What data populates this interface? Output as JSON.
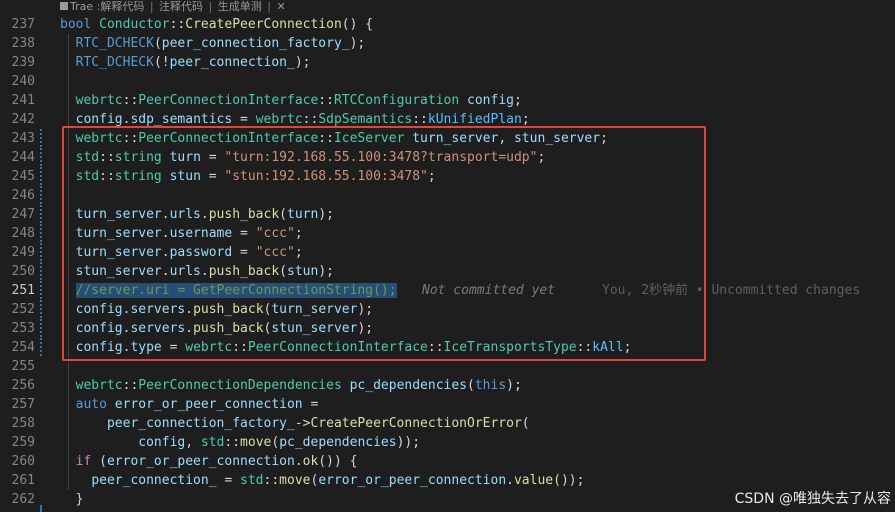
{
  "codelens": {
    "brand": "Trae",
    "explain": "解释代码",
    "comment": "注释代码",
    "unittest": "生成单测",
    "close": "✕"
  },
  "lines": [
    {
      "n": "237",
      "tokens": [
        [
          "kw",
          "bool"
        ],
        [
          "op",
          " "
        ],
        [
          "ty",
          "Conductor"
        ],
        [
          "op",
          "::"
        ],
        [
          "fn",
          "CreatePeerConnection"
        ],
        [
          "op",
          "() {"
        ]
      ]
    },
    {
      "n": "238",
      "tokens": [
        [
          "op",
          "  "
        ],
        [
          "mac",
          "RTC_DCHECK"
        ],
        [
          "op",
          "("
        ],
        [
          "var",
          "peer_connection_factory_"
        ],
        [
          "op",
          ");"
        ]
      ]
    },
    {
      "n": "239",
      "tokens": [
        [
          "op",
          "  "
        ],
        [
          "mac",
          "RTC_DCHECK"
        ],
        [
          "op",
          "(!"
        ],
        [
          "var",
          "peer_connection_"
        ],
        [
          "op",
          ");"
        ]
      ]
    },
    {
      "n": "240",
      "tokens": []
    },
    {
      "n": "241",
      "tokens": [
        [
          "op",
          "  "
        ],
        [
          "ty",
          "webrtc"
        ],
        [
          "op",
          "::"
        ],
        [
          "ty",
          "PeerConnectionInterface"
        ],
        [
          "op",
          "::"
        ],
        [
          "ty",
          "RTCConfiguration"
        ],
        [
          "op",
          " "
        ],
        [
          "var",
          "config"
        ],
        [
          "op",
          ";"
        ]
      ]
    },
    {
      "n": "242",
      "tokens": [
        [
          "op",
          "  "
        ],
        [
          "var",
          "config"
        ],
        [
          "op",
          "."
        ],
        [
          "var",
          "sdp_semantics"
        ],
        [
          "op",
          " = "
        ],
        [
          "ty",
          "webrtc"
        ],
        [
          "op",
          "::"
        ],
        [
          "ty",
          "SdpSemantics"
        ],
        [
          "op",
          "::"
        ],
        [
          "enum",
          "kUnifiedPlan"
        ],
        [
          "op",
          ";"
        ]
      ]
    },
    {
      "n": "243",
      "tokens": [
        [
          "op",
          "  "
        ],
        [
          "ty",
          "webrtc"
        ],
        [
          "op",
          "::"
        ],
        [
          "ty",
          "PeerConnectionInterface"
        ],
        [
          "op",
          "::"
        ],
        [
          "ty",
          "IceServer"
        ],
        [
          "op",
          " "
        ],
        [
          "var",
          "turn_server"
        ],
        [
          "op",
          ", "
        ],
        [
          "var",
          "stun_server"
        ],
        [
          "op",
          ";"
        ]
      ]
    },
    {
      "n": "244",
      "tokens": [
        [
          "op",
          "  "
        ],
        [
          "ty",
          "std"
        ],
        [
          "op",
          "::"
        ],
        [
          "ty",
          "string"
        ],
        [
          "op",
          " "
        ],
        [
          "var",
          "turn"
        ],
        [
          "op",
          " = "
        ],
        [
          "str",
          "\"turn:192.168.55.100:3478?transport=udp\""
        ],
        [
          "op",
          ";"
        ]
      ]
    },
    {
      "n": "245",
      "tokens": [
        [
          "op",
          "  "
        ],
        [
          "ty",
          "std"
        ],
        [
          "op",
          "::"
        ],
        [
          "ty",
          "string"
        ],
        [
          "op",
          " "
        ],
        [
          "var",
          "stun"
        ],
        [
          "op",
          " = "
        ],
        [
          "str",
          "\"stun:192.168.55.100:3478\""
        ],
        [
          "op",
          ";"
        ]
      ]
    },
    {
      "n": "246",
      "tokens": []
    },
    {
      "n": "247",
      "tokens": [
        [
          "op",
          "  "
        ],
        [
          "var",
          "turn_server"
        ],
        [
          "op",
          "."
        ],
        [
          "var",
          "urls"
        ],
        [
          "op",
          "."
        ],
        [
          "fn",
          "push_back"
        ],
        [
          "op",
          "("
        ],
        [
          "var",
          "turn"
        ],
        [
          "op",
          ");"
        ]
      ]
    },
    {
      "n": "248",
      "tokens": [
        [
          "op",
          "  "
        ],
        [
          "var",
          "turn_server"
        ],
        [
          "op",
          "."
        ],
        [
          "var",
          "username"
        ],
        [
          "op",
          " = "
        ],
        [
          "str",
          "\"ccc\""
        ],
        [
          "op",
          ";"
        ]
      ]
    },
    {
      "n": "249",
      "tokens": [
        [
          "op",
          "  "
        ],
        [
          "var",
          "turn_server"
        ],
        [
          "op",
          "."
        ],
        [
          "var",
          "password"
        ],
        [
          "op",
          " = "
        ],
        [
          "str",
          "\"ccc\""
        ],
        [
          "op",
          ";"
        ]
      ]
    },
    {
      "n": "250",
      "tokens": [
        [
          "op",
          "  "
        ],
        [
          "var",
          "stun_server"
        ],
        [
          "op",
          "."
        ],
        [
          "var",
          "urls"
        ],
        [
          "op",
          "."
        ],
        [
          "fn",
          "push_back"
        ],
        [
          "op",
          "("
        ],
        [
          "var",
          "stun"
        ],
        [
          "op",
          ");"
        ]
      ]
    },
    {
      "n": "251",
      "active": true,
      "tokens": [
        [
          "op",
          "  "
        ],
        [
          "cmt sel",
          "//server.uri = GetPeerConnectionString();"
        ]
      ]
    },
    {
      "n": "252",
      "tokens": [
        [
          "op",
          "  "
        ],
        [
          "var",
          "config"
        ],
        [
          "op",
          "."
        ],
        [
          "var",
          "servers"
        ],
        [
          "op",
          "."
        ],
        [
          "fn",
          "push_back"
        ],
        [
          "op",
          "("
        ],
        [
          "var",
          "turn_server"
        ],
        [
          "op",
          ");"
        ]
      ]
    },
    {
      "n": "253",
      "tokens": [
        [
          "op",
          "  "
        ],
        [
          "var",
          "config"
        ],
        [
          "op",
          "."
        ],
        [
          "var",
          "servers"
        ],
        [
          "op",
          "."
        ],
        [
          "fn",
          "push_back"
        ],
        [
          "op",
          "("
        ],
        [
          "var",
          "stun_server"
        ],
        [
          "op",
          ");"
        ]
      ]
    },
    {
      "n": "254",
      "tokens": [
        [
          "op",
          "  "
        ],
        [
          "var",
          "config"
        ],
        [
          "op",
          "."
        ],
        [
          "var",
          "type"
        ],
        [
          "op",
          " = "
        ],
        [
          "ty",
          "webrtc"
        ],
        [
          "op",
          "::"
        ],
        [
          "ty",
          "PeerConnectionInterface"
        ],
        [
          "op",
          "::"
        ],
        [
          "ty",
          "IceTransportsType"
        ],
        [
          "op",
          "::"
        ],
        [
          "enum",
          "kAll"
        ],
        [
          "op",
          ";"
        ]
      ]
    },
    {
      "n": "255",
      "tokens": []
    },
    {
      "n": "256",
      "tokens": [
        [
          "op",
          "  "
        ],
        [
          "ty",
          "webrtc"
        ],
        [
          "op",
          "::"
        ],
        [
          "ty",
          "PeerConnectionDependencies"
        ],
        [
          "op",
          " "
        ],
        [
          "var",
          "pc_dependencies"
        ],
        [
          "op",
          "("
        ],
        [
          "kw",
          "this"
        ],
        [
          "op",
          ");"
        ]
      ]
    },
    {
      "n": "257",
      "tokens": [
        [
          "op",
          "  "
        ],
        [
          "kw",
          "auto"
        ],
        [
          "op",
          " "
        ],
        [
          "var",
          "error_or_peer_connection"
        ],
        [
          "op",
          " ="
        ]
      ]
    },
    {
      "n": "258",
      "tokens": [
        [
          "op",
          "      "
        ],
        [
          "var",
          "peer_connection_factory_"
        ],
        [
          "op",
          "->"
        ],
        [
          "fn",
          "CreatePeerConnectionOrError"
        ],
        [
          "op",
          "("
        ]
      ]
    },
    {
      "n": "259",
      "tokens": [
        [
          "op",
          "          "
        ],
        [
          "var",
          "config"
        ],
        [
          "op",
          ", "
        ],
        [
          "ty",
          "std"
        ],
        [
          "op",
          "::"
        ],
        [
          "fn",
          "move"
        ],
        [
          "op",
          "("
        ],
        [
          "var",
          "pc_dependencies"
        ],
        [
          "op",
          "));"
        ]
      ]
    },
    {
      "n": "260",
      "tokens": [
        [
          "op",
          "  "
        ],
        [
          "ctl",
          "if"
        ],
        [
          "op",
          " ("
        ],
        [
          "var",
          "error_or_peer_connection"
        ],
        [
          "op",
          "."
        ],
        [
          "fn",
          "ok"
        ],
        [
          "op",
          "()) {"
        ]
      ]
    },
    {
      "n": "261",
      "tokens": [
        [
          "op",
          "    "
        ],
        [
          "var",
          "peer_connection_"
        ],
        [
          "op",
          " = "
        ],
        [
          "ty",
          "std"
        ],
        [
          "op",
          "::"
        ],
        [
          "fn",
          "move"
        ],
        [
          "op",
          "("
        ],
        [
          "var",
          "error_or_peer_connection"
        ],
        [
          "op",
          "."
        ],
        [
          "fn",
          "value"
        ],
        [
          "op",
          "());"
        ]
      ]
    },
    {
      "n": "262",
      "tokens": [
        [
          "op",
          "  }"
        ]
      ]
    }
  ],
  "blame": {
    "status": "Not committed yet",
    "author": "You, 2秒钟前 • Uncommitted changes"
  },
  "watermark": "CSDN @唯独失去了从容"
}
